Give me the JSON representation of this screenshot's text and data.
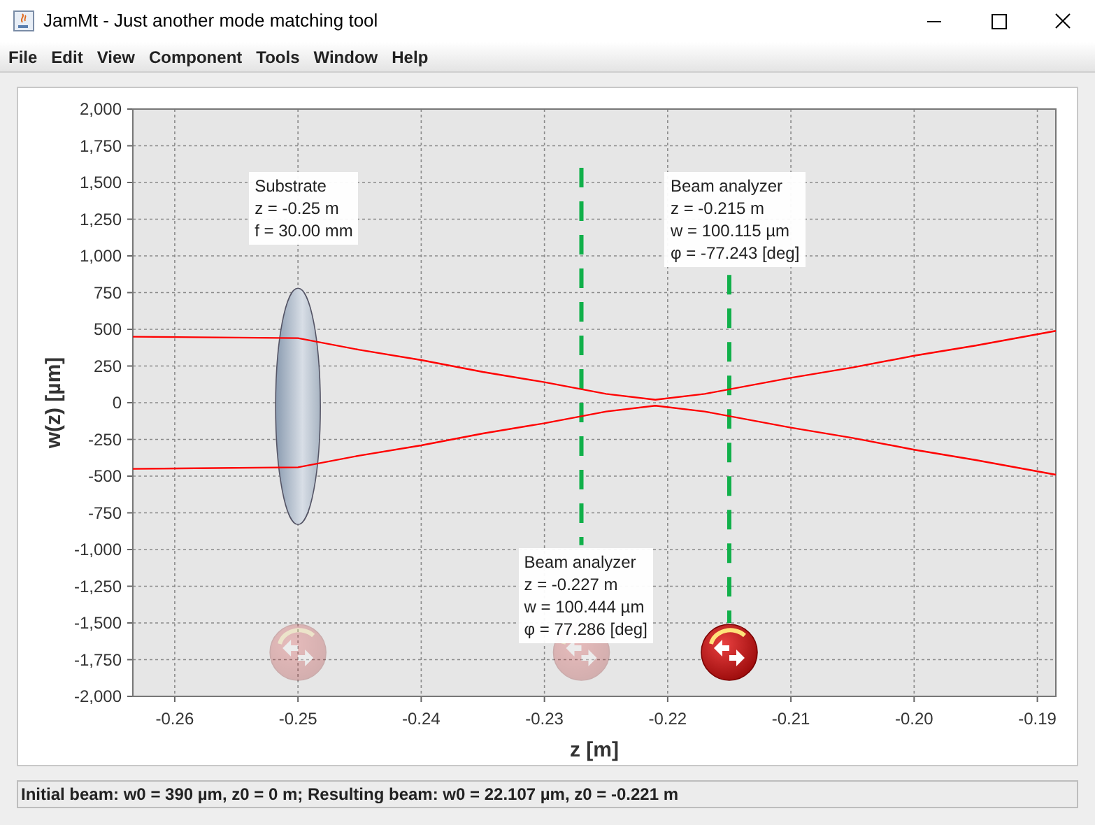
{
  "window": {
    "title": "JamMt - Just another mode matching tool"
  },
  "menu": [
    "File",
    "Edit",
    "View",
    "Component",
    "Tools",
    "Window",
    "Help"
  ],
  "plot": {
    "chart_data": {
      "type": "line",
      "xlabel": "z [m]",
      "ylabel": "w(z) [µm]",
      "x": [
        -0.2634,
        -0.25,
        -0.245,
        -0.24,
        -0.235,
        -0.23,
        -0.225,
        -0.221,
        -0.217,
        -0.21,
        -0.205,
        -0.2,
        -0.195,
        -0.1885
      ],
      "series": [
        {
          "color": "#ff0000",
          "values": [
            450,
            440,
            360,
            290,
            210,
            140,
            60,
            20,
            60,
            170,
            240,
            320,
            390,
            490
          ]
        },
        {
          "color": "#ff0000",
          "values": [
            -450,
            -440,
            -360,
            -290,
            -210,
            -140,
            -60,
            -20,
            -60,
            -170,
            -240,
            -320,
            -390,
            -490
          ]
        }
      ],
      "grid": true,
      "ref_lines": [
        {
          "axis": "x",
          "value": -0.227,
          "color": "#11b04a"
        },
        {
          "axis": "x",
          "value": -0.215,
          "color": "#11b04a"
        }
      ],
      "xlim": [
        -0.2634,
        -0.1885
      ],
      "ylim": [
        -2000,
        2000
      ],
      "xticks": [
        {
          "value": -0.26,
          "label": "-0.26"
        },
        {
          "value": -0.25,
          "label": "-0.25"
        },
        {
          "value": -0.24,
          "label": "-0.24"
        },
        {
          "value": -0.23,
          "label": "-0.23"
        },
        {
          "value": -0.22,
          "label": "-0.22"
        },
        {
          "value": -0.21,
          "label": "-0.21"
        },
        {
          "value": -0.2,
          "label": "-0.20"
        },
        {
          "value": -0.19,
          "label": "-0.19"
        }
      ],
      "yticks": [
        {
          "value": 2000,
          "label": "2,000"
        },
        {
          "value": 1750,
          "label": "1,750"
        },
        {
          "value": 1500,
          "label": "1,500"
        },
        {
          "value": 1250,
          "label": "1,250"
        },
        {
          "value": 1000,
          "label": "1,000"
        },
        {
          "value": 750,
          "label": "750"
        },
        {
          "value": 500,
          "label": "500"
        },
        {
          "value": 250,
          "label": "250"
        },
        {
          "value": 0,
          "label": "0"
        },
        {
          "value": -250,
          "label": "-250"
        },
        {
          "value": -500,
          "label": "-500"
        },
        {
          "value": -750,
          "label": "-750"
        },
        {
          "value": -1000,
          "label": "-1,000"
        },
        {
          "value": -1250,
          "label": "-1,250"
        },
        {
          "value": -1500,
          "label": "-1,500"
        },
        {
          "value": -1750,
          "label": "-1,750"
        },
        {
          "value": -2000,
          "label": "-2,000"
        }
      ]
    },
    "components": [
      {
        "kind": "lens",
        "selected": false,
        "label": [
          "Substrate",
          "z = -0.25 m",
          "f = 30.00 mm"
        ]
      },
      {
        "kind": "analyzer",
        "selected": false,
        "label": [
          "Beam analyzer",
          "z = -0.227 m",
          "w = 100.444 µm",
          "φ = 77.286 [deg]"
        ]
      },
      {
        "kind": "analyzer",
        "selected": true,
        "label": [
          "Beam analyzer",
          "z = -0.215 m",
          "w = 100.115 µm",
          "φ = -77.243 [deg]"
        ]
      }
    ]
  },
  "status_bar": "Initial beam: w0 = 390 µm, z0 = 0 m; Resulting beam: w0 = 22.107 µm, z0 = -0.221 m"
}
